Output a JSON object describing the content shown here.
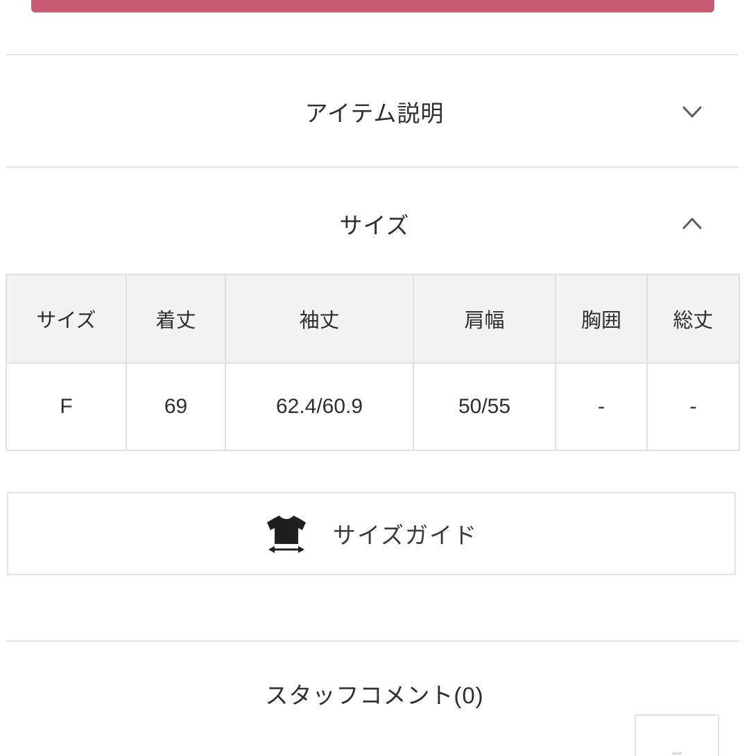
{
  "top_bar": {
    "name": "cart-button-cutoff",
    "color": "#c75a74"
  },
  "sections": {
    "item_description": {
      "title": "アイテム説明",
      "chevron": "chevron-down-icon",
      "expanded": "false"
    },
    "size": {
      "title": "サイズ",
      "chevron": "chevron-up-icon",
      "expanded": "true"
    },
    "staff_comment": {
      "title": "スタッフコメント(0)",
      "count": "0"
    }
  },
  "size_table": {
    "headers": [
      "サイズ",
      "着丈",
      "袖丈",
      "肩幅",
      "胸囲",
      "総丈"
    ],
    "rows": [
      [
        "F",
        "69",
        "62.4/60.9",
        "50/55",
        "-",
        "-"
      ]
    ]
  },
  "size_guide": {
    "label": "サイズガイド",
    "icon": "tshirt-measure-icon"
  }
}
